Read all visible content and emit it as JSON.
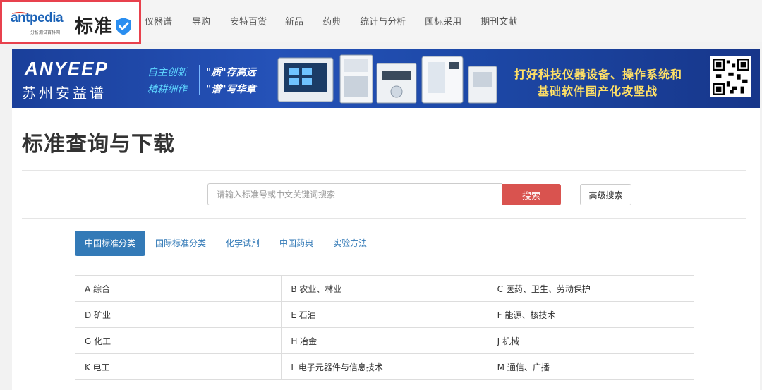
{
  "logo": {
    "brand": "antpedia",
    "subtitle": "分析测试百科网",
    "section": "标准"
  },
  "nav": {
    "items": [
      "仪器谱",
      "导购",
      "安特百货",
      "新品",
      "药典",
      "统计与分析",
      "国标采用",
      "期刊文献"
    ]
  },
  "banner": {
    "brand_en": "ANYEEP",
    "brand_cn": "苏州安益谱",
    "slogan_left_1": "自主创新",
    "slogan_left_2": "精耕细作",
    "slogan_mid_1": "\"质\"存高远",
    "slogan_mid_2": "\"谱\"写华章",
    "slogan_right_1": "打好科技仪器设备、操作系统和",
    "slogan_right_2": "基础软件国产化攻坚战"
  },
  "page": {
    "title": "标准查询与下载"
  },
  "search": {
    "placeholder": "请输入标准号或中文关键词搜索",
    "button": "搜索",
    "advanced": "高级搜索"
  },
  "tabs": [
    {
      "label": "中国标准分类",
      "active": true
    },
    {
      "label": "国际标准分类",
      "active": false
    },
    {
      "label": "化学试剂",
      "active": false
    },
    {
      "label": "中国药典",
      "active": false
    },
    {
      "label": "实验方法",
      "active": false
    }
  ],
  "categories": [
    [
      "A 综合",
      "B 农业、林业",
      "C 医药、卫生、劳动保护"
    ],
    [
      "D 矿业",
      "E 石油",
      "F 能源、核技术"
    ],
    [
      "G 化工",
      "H 冶金",
      "J 机械"
    ],
    [
      "K 电工",
      "L 电子元器件与信息技术",
      "M 通信、广播"
    ]
  ],
  "colors": {
    "accent": "#337ab7",
    "search_button": "#d9534f",
    "logo_highlight_border": "#e8414d"
  }
}
